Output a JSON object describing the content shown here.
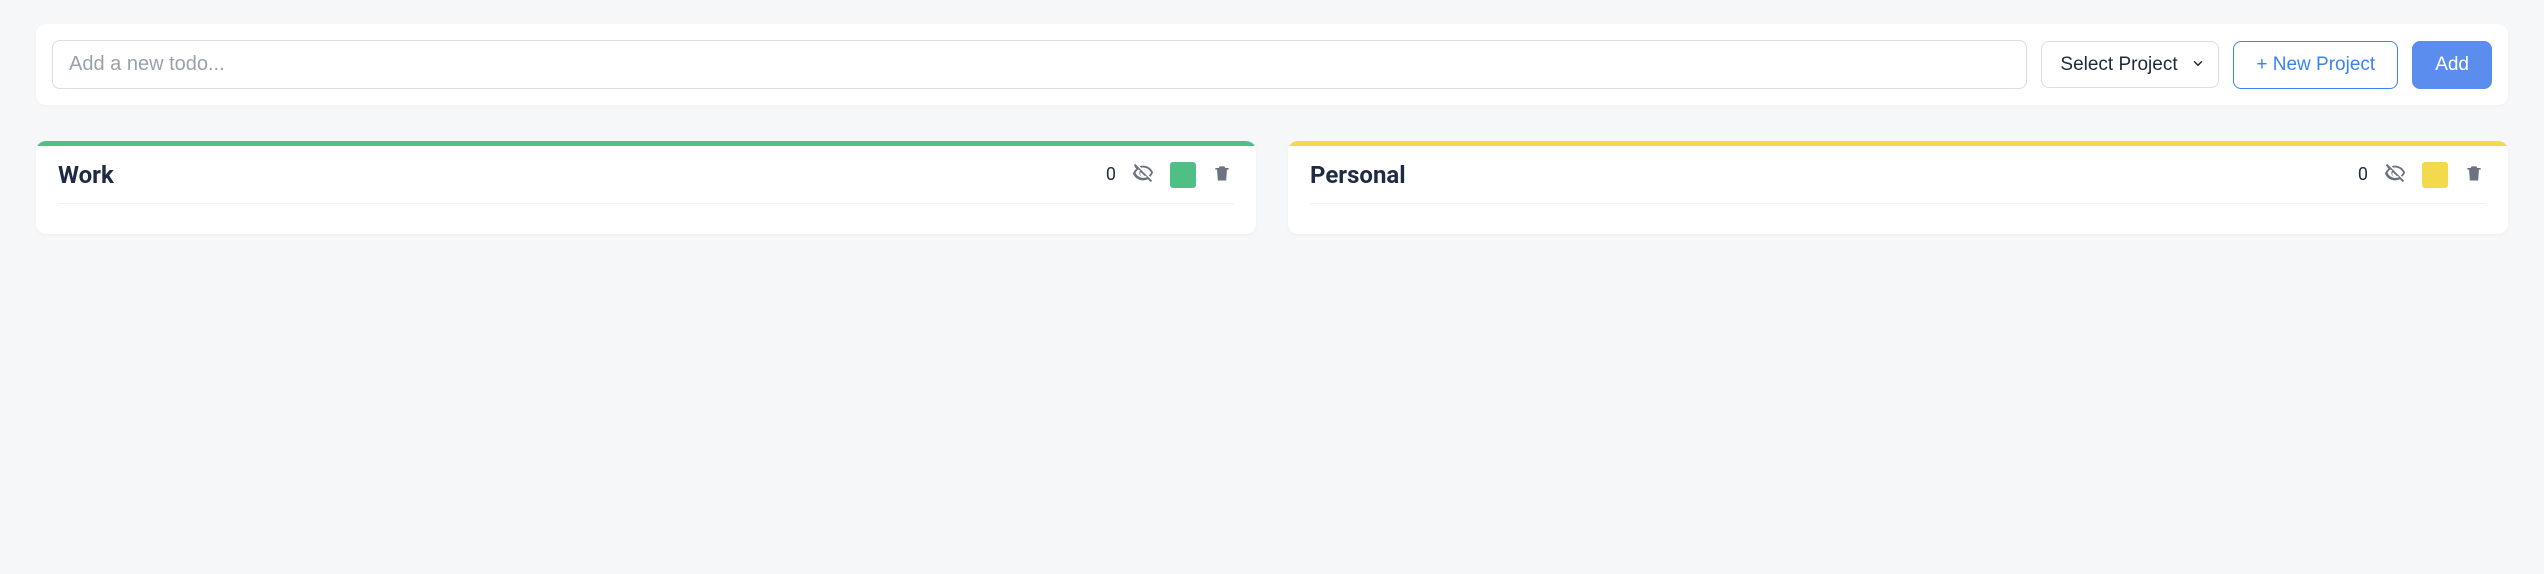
{
  "toolbar": {
    "todo_placeholder": "Add a new todo...",
    "select_label": "Select Project",
    "new_project_label": "+ New Project",
    "add_label": "Add"
  },
  "projects": [
    {
      "name": "Work",
      "count": "0",
      "color": "#4fbf86"
    },
    {
      "name": "Personal",
      "count": "0",
      "color": "#f3d94c"
    }
  ]
}
